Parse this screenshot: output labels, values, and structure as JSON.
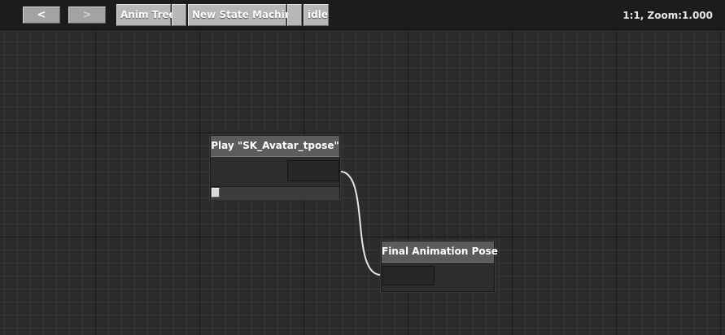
{
  "toolbar": {
    "back_label": "<",
    "forward_label": ">",
    "breadcrumbs": [
      "Anim Tree",
      "New State Machine",
      "idle"
    ],
    "zoom_label": "1:1, Zoom:1.000"
  },
  "nodes": {
    "play": {
      "title": "Play \"SK_Avatar_tpose\""
    },
    "final": {
      "title": "Final Animation Pose"
    }
  },
  "colors": {
    "background": "#2b2b2b",
    "node_title": "#5c5c5c",
    "wire": "#e6e6e6"
  }
}
